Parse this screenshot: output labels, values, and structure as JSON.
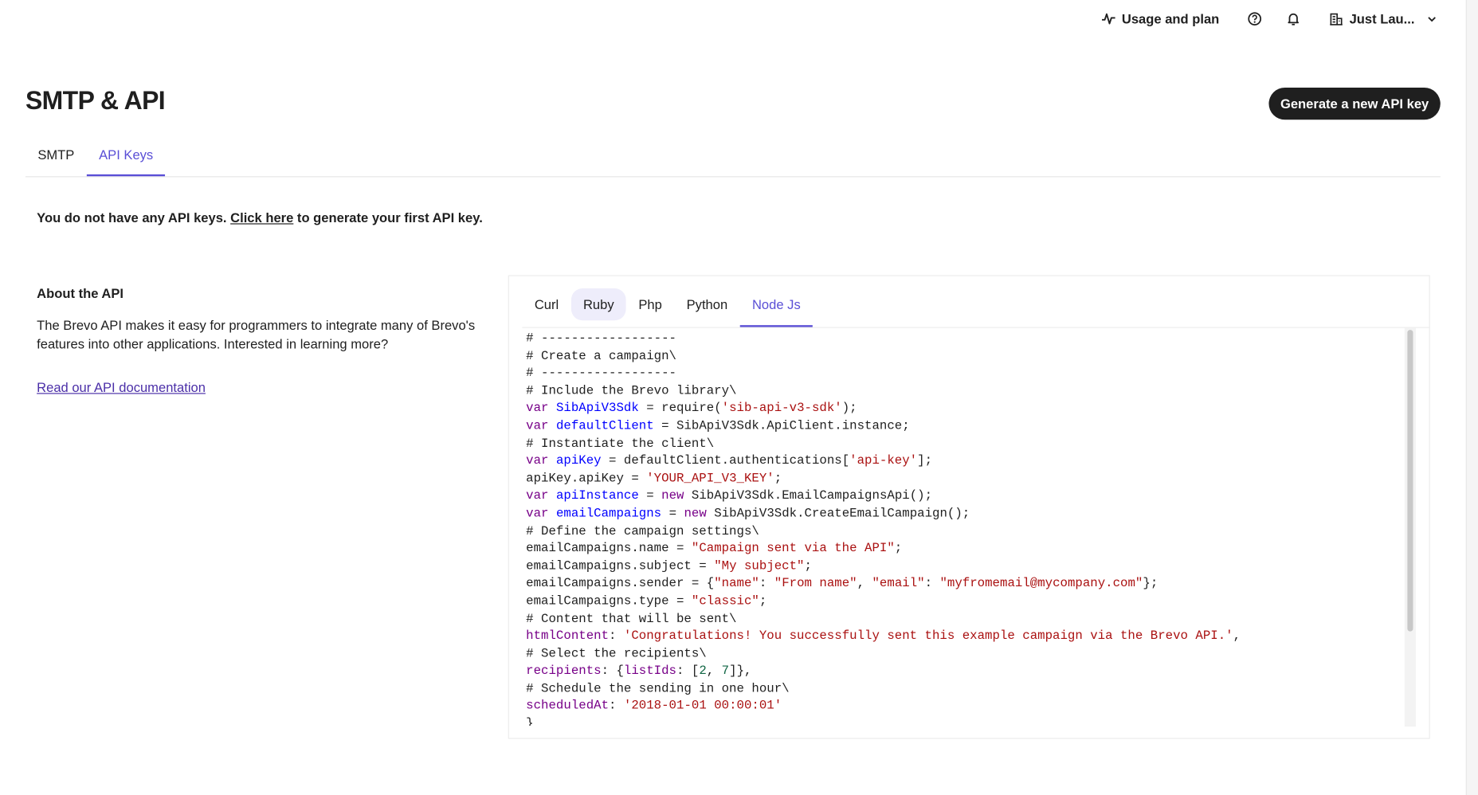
{
  "topbar": {
    "usage_label": "Usage and plan",
    "account_label": "Just Lau...",
    "icons": [
      "activity-icon",
      "help-icon",
      "bell-icon",
      "building-icon",
      "chevron-down-icon"
    ]
  },
  "page_title": "SMTP & API",
  "generate_button": "Generate a new API key",
  "tabs": [
    {
      "label": "SMTP"
    },
    {
      "label": "API Keys",
      "active": true
    }
  ],
  "notice": {
    "before": "You do not have any API keys. ",
    "link": "Click here",
    "after": " to generate your first API key."
  },
  "about": {
    "title": "About the API",
    "text": "The Brevo API makes it easy for programmers to integrate many of Brevo's features into other applications. Interested in learning more?",
    "link": "Read our API documentation"
  },
  "accent_color": "#5a4fd6",
  "code_tabs": [
    {
      "label": "Curl"
    },
    {
      "label": "Ruby",
      "hover": true
    },
    {
      "label": "Php"
    },
    {
      "label": "Python"
    },
    {
      "label": "Node Js",
      "active": true
    }
  ],
  "code_lines": [
    [
      {
        "t": "# ------------------",
        "c": ""
      }
    ],
    [
      {
        "t": "# Create a campaign\\",
        "c": ""
      }
    ],
    [
      {
        "t": "# ------------------",
        "c": ""
      }
    ],
    [
      {
        "t": "# Include the Brevo library\\",
        "c": ""
      }
    ],
    [
      {
        "t": "var",
        "c": "k"
      },
      {
        "t": " ",
        "c": ""
      },
      {
        "t": "SibApiV3Sdk",
        "c": "d"
      },
      {
        "t": " = require(",
        "c": ""
      },
      {
        "t": "'sib-api-v3-sdk'",
        "c": "s"
      },
      {
        "t": ");",
        "c": ""
      }
    ],
    [
      {
        "t": "var",
        "c": "k"
      },
      {
        "t": " ",
        "c": ""
      },
      {
        "t": "defaultClient",
        "c": "d"
      },
      {
        "t": " = SibApiV3Sdk.ApiClient.instance;",
        "c": ""
      }
    ],
    [
      {
        "t": "# Instantiate the client\\",
        "c": ""
      }
    ],
    [
      {
        "t": "var",
        "c": "k"
      },
      {
        "t": " ",
        "c": ""
      },
      {
        "t": "apiKey",
        "c": "d"
      },
      {
        "t": " = defaultClient.authentications[",
        "c": ""
      },
      {
        "t": "'api-key'",
        "c": "s"
      },
      {
        "t": "];",
        "c": ""
      }
    ],
    [
      {
        "t": "apiKey.apiKey = ",
        "c": ""
      },
      {
        "t": "'YOUR_API_V3_KEY'",
        "c": "s"
      },
      {
        "t": ";",
        "c": ""
      }
    ],
    [
      {
        "t": "var",
        "c": "k"
      },
      {
        "t": " ",
        "c": ""
      },
      {
        "t": "apiInstance",
        "c": "d"
      },
      {
        "t": " = ",
        "c": ""
      },
      {
        "t": "new",
        "c": "k"
      },
      {
        "t": " SibApiV3Sdk.EmailCampaignsApi();",
        "c": ""
      }
    ],
    [
      {
        "t": "var",
        "c": "k"
      },
      {
        "t": " ",
        "c": ""
      },
      {
        "t": "emailCampaigns",
        "c": "d"
      },
      {
        "t": " = ",
        "c": ""
      },
      {
        "t": "new",
        "c": "k"
      },
      {
        "t": " SibApiV3Sdk.CreateEmailCampaign();",
        "c": ""
      }
    ],
    [
      {
        "t": "# Define the campaign settings\\",
        "c": ""
      }
    ],
    [
      {
        "t": "emailCampaigns.name = ",
        "c": ""
      },
      {
        "t": "\"Campaign sent via the API\"",
        "c": "s"
      },
      {
        "t": ";",
        "c": ""
      }
    ],
    [
      {
        "t": "emailCampaigns.subject = ",
        "c": ""
      },
      {
        "t": "\"My subject\"",
        "c": "s"
      },
      {
        "t": ";",
        "c": ""
      }
    ],
    [
      {
        "t": "emailCampaigns.sender = {",
        "c": ""
      },
      {
        "t": "\"name\"",
        "c": "s"
      },
      {
        "t": ": ",
        "c": ""
      },
      {
        "t": "\"From name\"",
        "c": "s"
      },
      {
        "t": ", ",
        "c": ""
      },
      {
        "t": "\"email\"",
        "c": "s"
      },
      {
        "t": ": ",
        "c": ""
      },
      {
        "t": "\"myfromemail@mycompany.com\"",
        "c": "s"
      },
      {
        "t": "};",
        "c": ""
      }
    ],
    [
      {
        "t": "emailCampaigns.type = ",
        "c": ""
      },
      {
        "t": "\"classic\"",
        "c": "s"
      },
      {
        "t": ";",
        "c": ""
      }
    ],
    [
      {
        "t": "# Content that will be sent\\",
        "c": ""
      }
    ],
    [
      {
        "t": "htmlContent",
        "c": "p"
      },
      {
        "t": ": ",
        "c": ""
      },
      {
        "t": "'Congratulations! You successfully sent this example campaign via the Brevo API.'",
        "c": "s"
      },
      {
        "t": ",",
        "c": ""
      }
    ],
    [
      {
        "t": "# Select the recipients\\",
        "c": ""
      }
    ],
    [
      {
        "t": "recipients",
        "c": "p"
      },
      {
        "t": ": {",
        "c": ""
      },
      {
        "t": "listIds",
        "c": "p"
      },
      {
        "t": ": [",
        "c": ""
      },
      {
        "t": "2",
        "c": "n"
      },
      {
        "t": ", ",
        "c": ""
      },
      {
        "t": "7",
        "c": "n"
      },
      {
        "t": "]},",
        "c": ""
      }
    ],
    [
      {
        "t": "# Schedule the sending in one hour\\",
        "c": ""
      }
    ],
    [
      {
        "t": "scheduledAt",
        "c": "p"
      },
      {
        "t": ": ",
        "c": ""
      },
      {
        "t": "'2018-01-01 00:00:01'",
        "c": "s"
      }
    ],
    [
      {
        "t": "}",
        "c": ""
      }
    ]
  ]
}
